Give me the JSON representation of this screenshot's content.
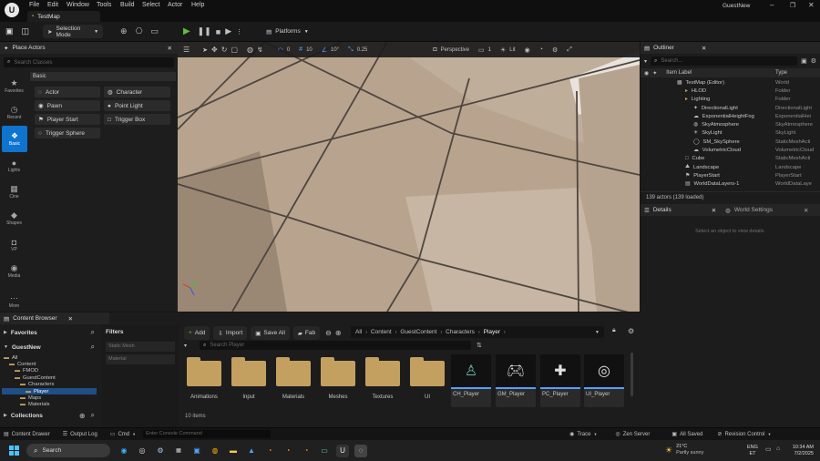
{
  "app": {
    "tab_title": "TestMap",
    "user": "GuestNew"
  },
  "menu": [
    "File",
    "Edit",
    "Window",
    "Tools",
    "Build",
    "Select",
    "Actor",
    "Help"
  ],
  "toolbar": {
    "selection_mode": "Selection Mode",
    "platforms": "Platforms"
  },
  "viewport": {
    "snap_angle": "10°",
    "grid_snap": "10",
    "rotate_snap": "0",
    "scale_snap": "0.25",
    "view_mode": "Perspective",
    "lit": "Lit",
    "screen_pct": "1"
  },
  "place_actors": {
    "title": "Place Actors",
    "search_placeholder": "Search Classes",
    "category": "Basic",
    "sidebar": [
      "Favorites",
      "Recent",
      "Basic",
      "Lights",
      "Cine",
      "Shapes",
      "VP",
      "Media",
      "More"
    ],
    "actors_left": [
      "Actor",
      "Pawn",
      "Player Start",
      "Trigger Sphere"
    ],
    "actors_right": [
      "Character",
      "Point Light",
      "Trigger Box"
    ]
  },
  "outliner": {
    "title": "Outliner",
    "search_placeholder": "Search...",
    "col_label": "Item Label",
    "col_type": "Type",
    "rows": [
      {
        "label": "TestMap (Editor)",
        "type": "World",
        "indent": 0
      },
      {
        "label": "HLOD",
        "type": "Folder",
        "indent": 1
      },
      {
        "label": "Lighting",
        "type": "Folder",
        "indent": 1
      },
      {
        "label": "DirectionalLight",
        "type": "DirectionalLight",
        "indent": 2
      },
      {
        "label": "ExponentialHeightFog",
        "type": "ExponentialHei",
        "indent": 2
      },
      {
        "label": "SkyAtmosphere",
        "type": "SkyAtmosphere",
        "indent": 2
      },
      {
        "label": "SkyLight",
        "type": "SkyLight",
        "indent": 2
      },
      {
        "label": "SM_SkySphere",
        "type": "StaticMeshActi",
        "indent": 2
      },
      {
        "label": "VolumetricCloud",
        "type": "VolumetricCloud",
        "indent": 2
      },
      {
        "label": "Cube",
        "type": "StaticMeshActi",
        "indent": 1
      },
      {
        "label": "Landscape",
        "type": "Landscape",
        "indent": 1
      },
      {
        "label": "PlayerStart",
        "type": "PlayerStart",
        "indent": 1
      },
      {
        "label": "WorldDataLayers-1",
        "type": "WorldDataLaye",
        "indent": 1
      }
    ],
    "footer": "139 actors (139 loaded)"
  },
  "details": {
    "tab_details": "Details",
    "tab_world": "World Settings",
    "empty_text": "Select an object to view details."
  },
  "content_browser": {
    "title": "Content Browser",
    "favorites": "Favorites",
    "root": "GuestNew",
    "tree": [
      {
        "label": "All",
        "indent": 0
      },
      {
        "label": "Content",
        "indent": 1
      },
      {
        "label": "FMOD",
        "indent": 2
      },
      {
        "label": "GuestContent",
        "indent": 2
      },
      {
        "label": "Characters",
        "indent": 3
      },
      {
        "label": "Player",
        "indent": 4
      },
      {
        "label": "Maps",
        "indent": 3
      },
      {
        "label": "Materials",
        "indent": 3
      }
    ],
    "collections": "Collections",
    "filters": "Filters",
    "filter_items": [
      "Static Mesh",
      "Material"
    ],
    "btn_add": "Add",
    "btn_import": "Import",
    "btn_save_all": "Save All",
    "btn_fab": "Fab",
    "breadcrumb": [
      "All",
      "Content",
      "GuestContent",
      "Characters",
      "Player"
    ],
    "search_placeholder": "Search Player",
    "folders": [
      "Animations",
      "Input",
      "Materials",
      "Meshes",
      "Textures",
      "UI"
    ],
    "blueprints": [
      "CH_Player",
      "GM_Player",
      "PC_Player",
      "UI_Player"
    ],
    "item_count": "10 items"
  },
  "statusbar": {
    "content_drawer": "Content Drawer",
    "output_log": "Output Log",
    "cmd": "Cmd",
    "console_placeholder": "Enter Console Command",
    "trace": "Trace",
    "zen": "Zen Server",
    "saved": "All Saved",
    "revision": "Revision Control"
  },
  "taskbar": {
    "search": "Search",
    "weather_temp": "21°C",
    "weather_desc": "Partly sunny",
    "lang1": "ENG",
    "lang2": "ET",
    "time": "10:34 AM",
    "date": "7/2/2025"
  },
  "colors": {
    "accent": "#0f73d0",
    "folder": "#c4a060",
    "viewport_floor": "#b8a48e",
    "selected": "#1f4f86"
  }
}
